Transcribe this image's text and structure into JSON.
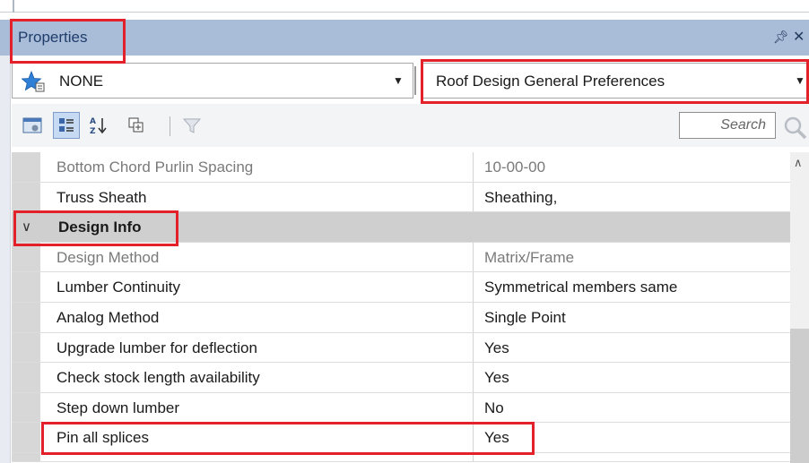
{
  "panel": {
    "title": "Properties"
  },
  "style_dropdown": {
    "value": "NONE"
  },
  "category_dropdown": {
    "value": "Roof Design General Preferences"
  },
  "toolbar": {
    "search_placeholder": "Search"
  },
  "rows_before": [
    {
      "name": "Bottom Chord Purlin Spacing",
      "value": "10-00-00",
      "muted": true
    },
    {
      "name": "Truss Sheath",
      "value": "Sheathing,",
      "muted": false
    }
  ],
  "category": {
    "name": "Design Info",
    "expanded": true
  },
  "rows_after": [
    {
      "name": "Design Method",
      "value": "Matrix/Frame",
      "muted": true
    },
    {
      "name": "Lumber Continuity",
      "value": "Symmetrical members same",
      "muted": false
    },
    {
      "name": "Analog Method",
      "value": "Single Point",
      "muted": false
    },
    {
      "name": "Upgrade lumber for deflection",
      "value": "Yes",
      "muted": false
    },
    {
      "name": "Check stock length availability",
      "value": "Yes",
      "muted": false
    },
    {
      "name": "Step down lumber",
      "value": "No",
      "muted": false
    },
    {
      "name": "Pin all splices",
      "value": "Yes",
      "muted": false
    }
  ],
  "colors": {
    "highlight": "#e3212b",
    "title_bar": "#a9bcd8",
    "category_row": "#cfcfcf"
  }
}
